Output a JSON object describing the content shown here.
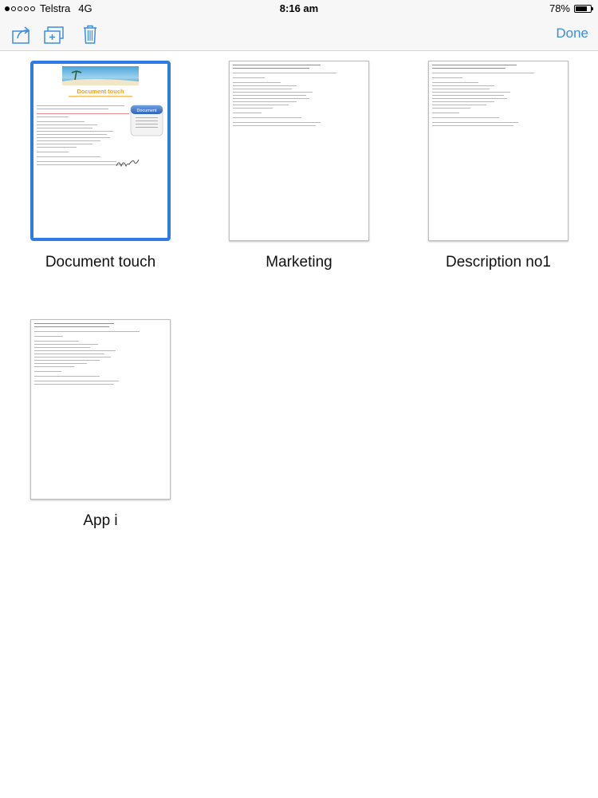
{
  "status_bar": {
    "carrier": "Telstra",
    "network": "4G",
    "time": "8:16 am",
    "battery": "78%",
    "battery_level": 0.78,
    "signal_bars": 1
  },
  "toolbar": {
    "actions": [
      "share-icon",
      "new-folder-icon",
      "trash-icon"
    ],
    "done_label": "Done",
    "accent_color": "#3b8de0"
  },
  "documents": [
    {
      "name": "Document touch",
      "selected": true,
      "thumbnail_title": "Document touch",
      "badge": "Document"
    },
    {
      "name": "Marketing",
      "selected": false
    },
    {
      "name": "Description no1",
      "selected": false
    },
    {
      "name": "App i",
      "selected": false
    }
  ],
  "selection_color": "#2f7ae6"
}
